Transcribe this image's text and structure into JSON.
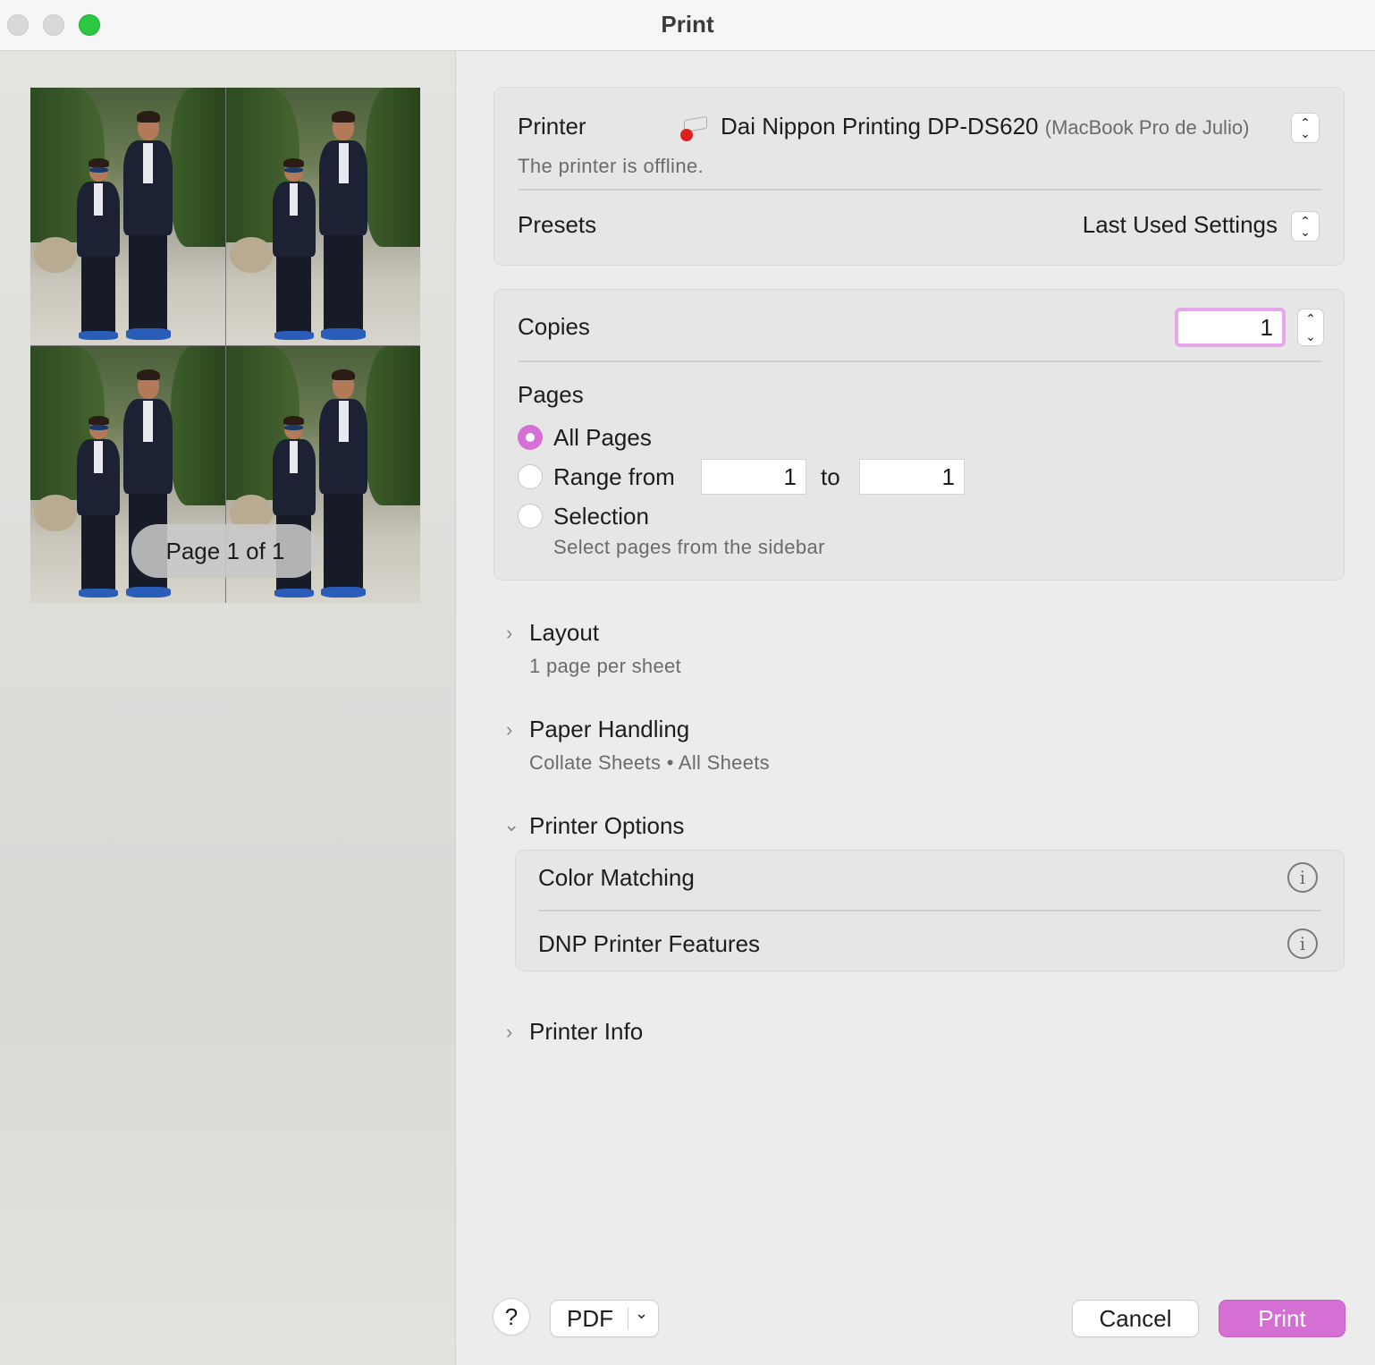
{
  "window": {
    "title": "Print"
  },
  "preview": {
    "page_indicator": "Page 1 of 1"
  },
  "printer_card": {
    "printer_label": "Printer",
    "printer_name": "Dai Nippon Printing DP-DS620",
    "printer_host": "(MacBook Pro de Julio)",
    "printer_status": "The printer is offline.",
    "presets_label": "Presets",
    "presets_value": "Last Used Settings"
  },
  "copies_card": {
    "copies_label": "Copies",
    "copies_value": "1",
    "pages_label": "Pages",
    "all_pages_label": "All Pages",
    "range_from_label": "Range from",
    "range_from_value": "1",
    "range_to_label": "to",
    "range_to_value": "1",
    "selection_label": "Selection",
    "selection_hint": "Select pages from the sidebar"
  },
  "sections": {
    "layout": {
      "title": "Layout",
      "summary": "1 page per sheet"
    },
    "paper_handling": {
      "title": "Paper Handling",
      "summary": "Collate Sheets • All Sheets"
    },
    "printer_options": {
      "title": "Printer Options",
      "items": [
        "Color Matching",
        "DNP Printer Features"
      ]
    },
    "printer_info": {
      "title": "Printer Info"
    }
  },
  "footer": {
    "help_label": "?",
    "pdf_label": "PDF",
    "cancel_label": "Cancel",
    "print_label": "Print"
  },
  "colors": {
    "accent": "#d46fd4",
    "focus_ring": "#e7a5ea",
    "zoom_button": "#2bc840"
  },
  "icons": {
    "printer": "printer-icon",
    "popup": "chevron-up-down-icon",
    "info": "info-circle-icon",
    "disclosure_closed": "chevron-right-icon",
    "disclosure_open": "chevron-down-icon"
  }
}
